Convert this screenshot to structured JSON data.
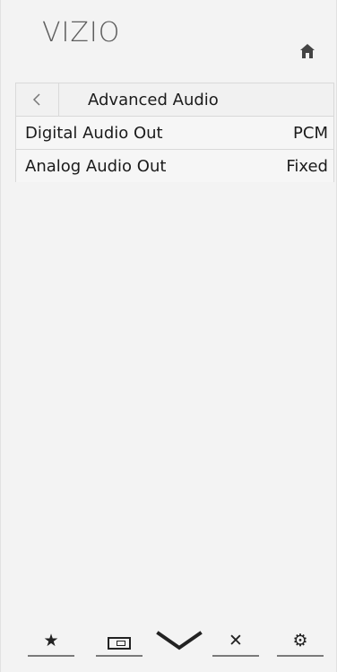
{
  "app": {
    "brand": "VIZIO"
  },
  "header": {
    "title": "Advanced Audio"
  },
  "menu": {
    "items": [
      {
        "label": "Digital Audio Out",
        "value": "PCM"
      },
      {
        "label": "Analog Audio Out",
        "value": "Fixed"
      }
    ]
  },
  "toolbar": {
    "items": [
      {
        "icon": "star-icon"
      },
      {
        "icon": "input-icon"
      },
      {
        "icon": "vizio-v-icon"
      },
      {
        "icon": "close-icon"
      },
      {
        "icon": "gear-icon"
      }
    ]
  },
  "colors": {
    "background": "#f3f3f3",
    "text": "#1b1b1b",
    "brand": "#5e5e5e",
    "border": "#d9d9d9"
  }
}
